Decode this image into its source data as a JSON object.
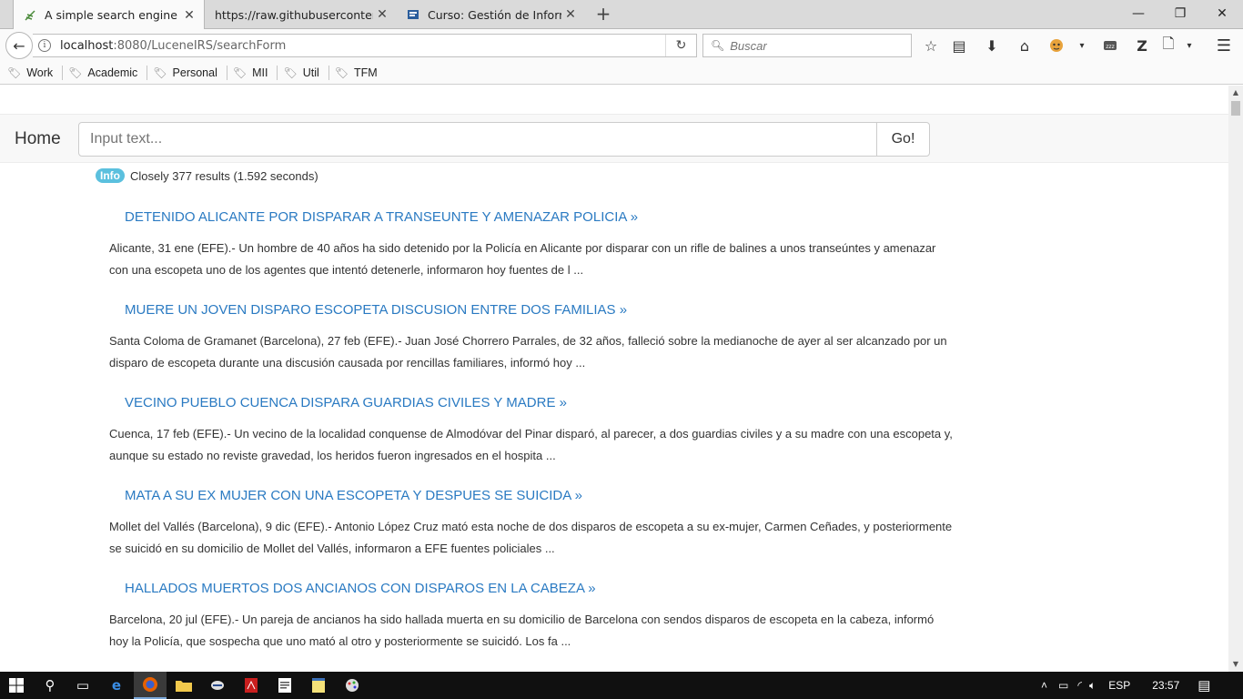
{
  "browser": {
    "tabs": [
      {
        "label": "A simple search engine with",
        "icon": "leaf-icon",
        "active": true
      },
      {
        "label": "https://raw.githubusercontent.c",
        "icon": "none",
        "active": false
      },
      {
        "label": "Curso: Gestión de Informaci",
        "icon": "moodle-icon",
        "active": false
      }
    ],
    "url_host": "localhost",
    "url_path": ":8080/LuceneIRS/searchForm",
    "search_placeholder": "Buscar",
    "bookmarks": [
      "Work",
      "Academic",
      "Personal",
      "MII",
      "Util",
      "TFM"
    ]
  },
  "page": {
    "brand": "Home",
    "query_placeholder": "Input text...",
    "go_label": "Go!",
    "info_badge": "Info",
    "status_text": "Closely 377 results (1.592 seconds)",
    "results": [
      {
        "title": "DETENIDO ALICANTE POR DISPARAR A TRANSEUNTE Y AMENAZAR POLICIA »",
        "snippet": "Alicante, 31 ene (EFE).- Un hombre de 40 años ha sido detenido por la Policía en Alicante por disparar con un rifle de balines a unos transeúntes y amenazar con una escopeta uno de los agentes que intentó detenerle, informaron hoy fuentes de l ..."
      },
      {
        "title": "MUERE UN JOVEN DISPARO ESCOPETA DISCUSION ENTRE DOS FAMILIAS »",
        "snippet": "Santa Coloma de Gramanet (Barcelona), 27 feb (EFE).- Juan José Chorrero Parrales, de 32 años, falleció sobre la medianoche de ayer al ser alcanzado por un disparo de escopeta durante una discusión causada por rencillas familiares, informó hoy ..."
      },
      {
        "title": "VECINO PUEBLO CUENCA DISPARA GUARDIAS CIVILES Y MADRE »",
        "snippet": "Cuenca, 17 feb (EFE).- Un vecino de la localidad conquense de Almodóvar del Pinar disparó, al parecer, a dos guardias civiles y a su madre con una escopeta y, aunque su estado no reviste gravedad, los heridos fueron ingresados en el hospita ..."
      },
      {
        "title": "MATA A SU EX MUJER CON UNA ESCOPETA Y DESPUES SE SUICIDA »",
        "snippet": "Mollet del Vallés (Barcelona), 9 dic (EFE).- Antonio López Cruz mató esta noche de dos disparos de escopeta a su ex-mujer, Carmen Ceñades, y posteriormente se suicidó en su domicilio de Mollet del Vallés, informaron a EFE fuentes policiales ..."
      },
      {
        "title": "HALLADOS MUERTOS DOS ANCIANOS CON DISPAROS EN LA CABEZA »",
        "snippet": "Barcelona, 20 jul (EFE).- Un pareja de ancianos ha sido hallada muerta en su domicilio de Barcelona con sendos disparos de escopeta en la cabeza, informó hoy la Policía, que sospecha que uno mató al otro y posteriormente se suicidó. Los fa ..."
      }
    ]
  },
  "taskbar": {
    "language": "ESP",
    "time": "23:57"
  },
  "colors": {
    "link": "#2a7ac2",
    "info_badge": "#5bc0de"
  }
}
